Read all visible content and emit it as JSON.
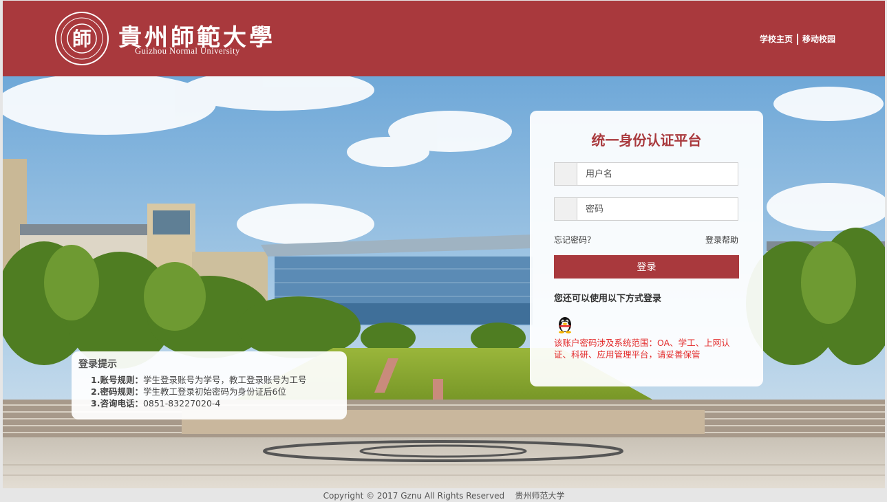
{
  "header": {
    "seal_char": "師",
    "brand_cn": "貴州師範大學",
    "brand_en": "Guizhou Normal University",
    "nav": [
      "学校主页",
      "移动校园"
    ]
  },
  "login": {
    "title": "统一身份认证平台",
    "username_placeholder": "用户名",
    "password_placeholder": "密码",
    "forgot": "忘记密码？",
    "help": "登录帮助",
    "submit": "登录",
    "alt_title": "您还可以使用以下方式登录",
    "alt_icon": "qq-penguin-icon",
    "notice": "该账户密码涉及系统范围：OA、学工、上网认证、科研、应用管理平台，请妥善保管"
  },
  "tips": {
    "title": "登录提示",
    "items": [
      {
        "label": "1.账号规则：",
        "text": "学生登录账号为学号，教工登录账号为工号"
      },
      {
        "label": "2.密码规则：",
        "text": "学生教工登录初始密码为身份证后6位"
      },
      {
        "label": "3.咨询电话：",
        "text": "0851-83227020-4"
      }
    ]
  },
  "footer": {
    "text": "Copyright © 2017 Gznu All Rights Reserved    贵州师范大学"
  },
  "colors": {
    "brand": "#a9393d",
    "notice": "#e32b2b"
  }
}
